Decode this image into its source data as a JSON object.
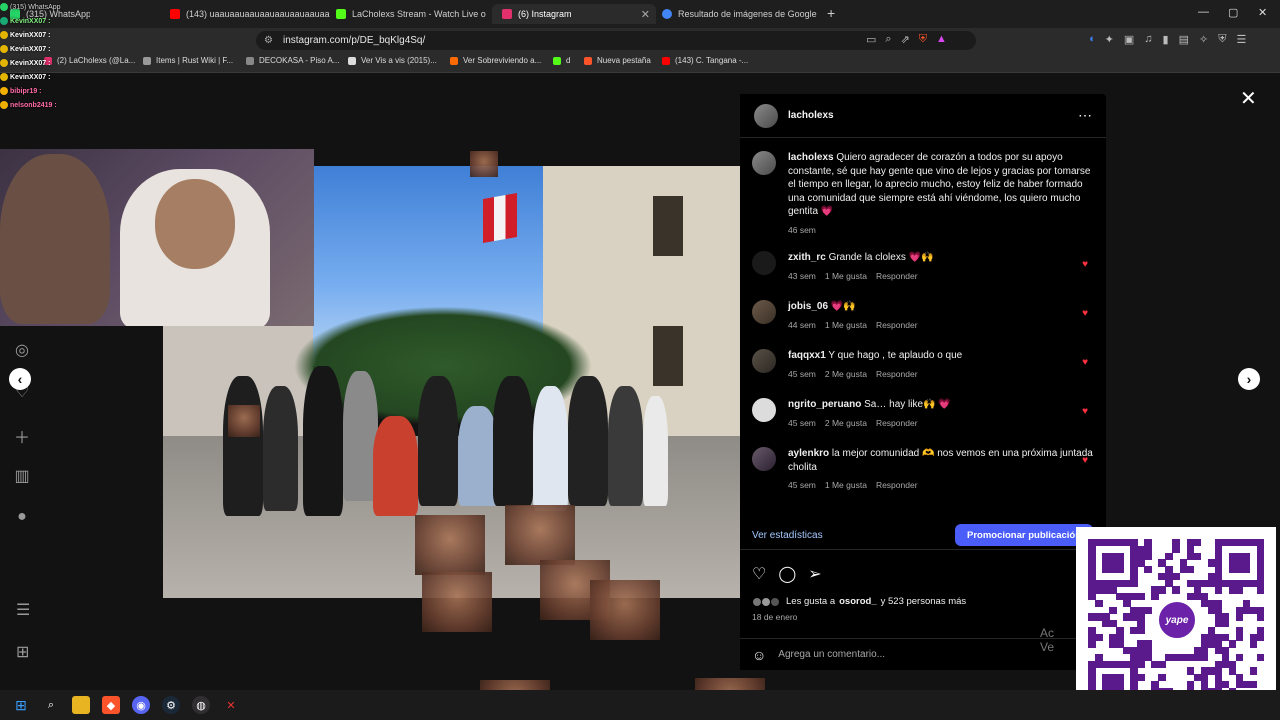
{
  "browser": {
    "tabs": [
      {
        "label": "(315) WhatsApp",
        "color": "#25d366",
        "active": false
      },
      {
        "label": "(143) uaauaauaauaauaauaauaauaauau",
        "color": "#ff0000",
        "active": false
      },
      {
        "label": "LaCholexs Stream - Watch Live on Ki",
        "color": "#53fc18",
        "active": false
      },
      {
        "label": "(6) Instagram",
        "color": "#e1306c",
        "active": true
      },
      {
        "label": "Resultado de imágenes de Google",
        "color": "#4285f4",
        "active": false
      }
    ],
    "new_tab": "+",
    "url": "instagram.com/p/DE_bqKlg4Sq/",
    "window_controls": {
      "minimize": "—",
      "maximize": "▢",
      "close": "✕"
    },
    "bookmarks": [
      {
        "label": "(2) LaCholexs (@La...",
        "color": "#e1306c"
      },
      {
        "label": "Items | Rust Wiki | F...",
        "color": "#999999"
      },
      {
        "label": "DECOKASA - Piso A...",
        "color": "#888888"
      },
      {
        "label": "Ver Vis a vis (2015)...",
        "color": "#dddddd"
      },
      {
        "label": "Ver Sobreviviendo a...",
        "color": "#ff6a00"
      },
      {
        "label": "d",
        "color": "#53fc18"
      },
      {
        "label": "Nueva pestaña",
        "color": "#fb542b"
      },
      {
        "label": "(143) C. Tangana -...",
        "color": "#ff0000"
      }
    ]
  },
  "chat": {
    "lines": [
      {
        "user": "KevinXX07 :"
      },
      {
        "user": "KevinXX07 :"
      },
      {
        "user": "KevinXX07 :"
      },
      {
        "user": "KevinXX07 :"
      },
      {
        "user": "KevinXX07 :"
      },
      {
        "user": "bibipr19 :"
      },
      {
        "user": "nelsonb2419 :"
      }
    ]
  },
  "post": {
    "username": "lacholexs",
    "caption": {
      "user": "lacholexs",
      "text": "Quiero agradecer de corazón a todos por su apoyo constante, sé que hay gente que vino de lejos y gracias por tomarse el tiempo en llegar, lo aprecio mucho, estoy feliz de haber formado una comunidad que siempre está ahí viéndome, los quiero mucho gentita 💗",
      "time": "46 sem"
    },
    "comments": [
      {
        "user": "zxith_rc",
        "text": "Grande la clolexs 💗🙌",
        "time": "43 sem",
        "likes": "1 Me gusta",
        "reply": "Responder"
      },
      {
        "user": "jobis_06",
        "text": "💗🙌",
        "time": "44 sem",
        "likes": "1 Me gusta",
        "reply": "Responder"
      },
      {
        "user": "faqqxx1",
        "text": "Y que hago , te aplaudo o que",
        "time": "45 sem",
        "likes": "2 Me gusta",
        "reply": "Responder"
      },
      {
        "user": "ngrito_peruano",
        "text": "Sa… hay like🙌 💗",
        "time": "45 sem",
        "likes": "2 Me gusta",
        "reply": "Responder"
      },
      {
        "user": "aylenkro",
        "text": "la mejor comunidad 🫶 nos vemos en una próxima juntada cholita",
        "time": "45 sem",
        "likes": "1 Me gusta",
        "reply": "Responder"
      }
    ],
    "stats_link": "Ver estadísticas",
    "promote_button": "Promocionar publicación",
    "likes_text": "Les gusta a",
    "likes_user": "osorod_",
    "likes_rest": "y 523 personas más",
    "date": "18 de enero",
    "comment_placeholder": "Agrega un comentario...",
    "heart_color": "#ff3040",
    "promote_color": "#4a5df9"
  },
  "qr": {
    "logo_text": "yape",
    "color": "#5a1a8c"
  },
  "watermark": "Ac\nVe"
}
